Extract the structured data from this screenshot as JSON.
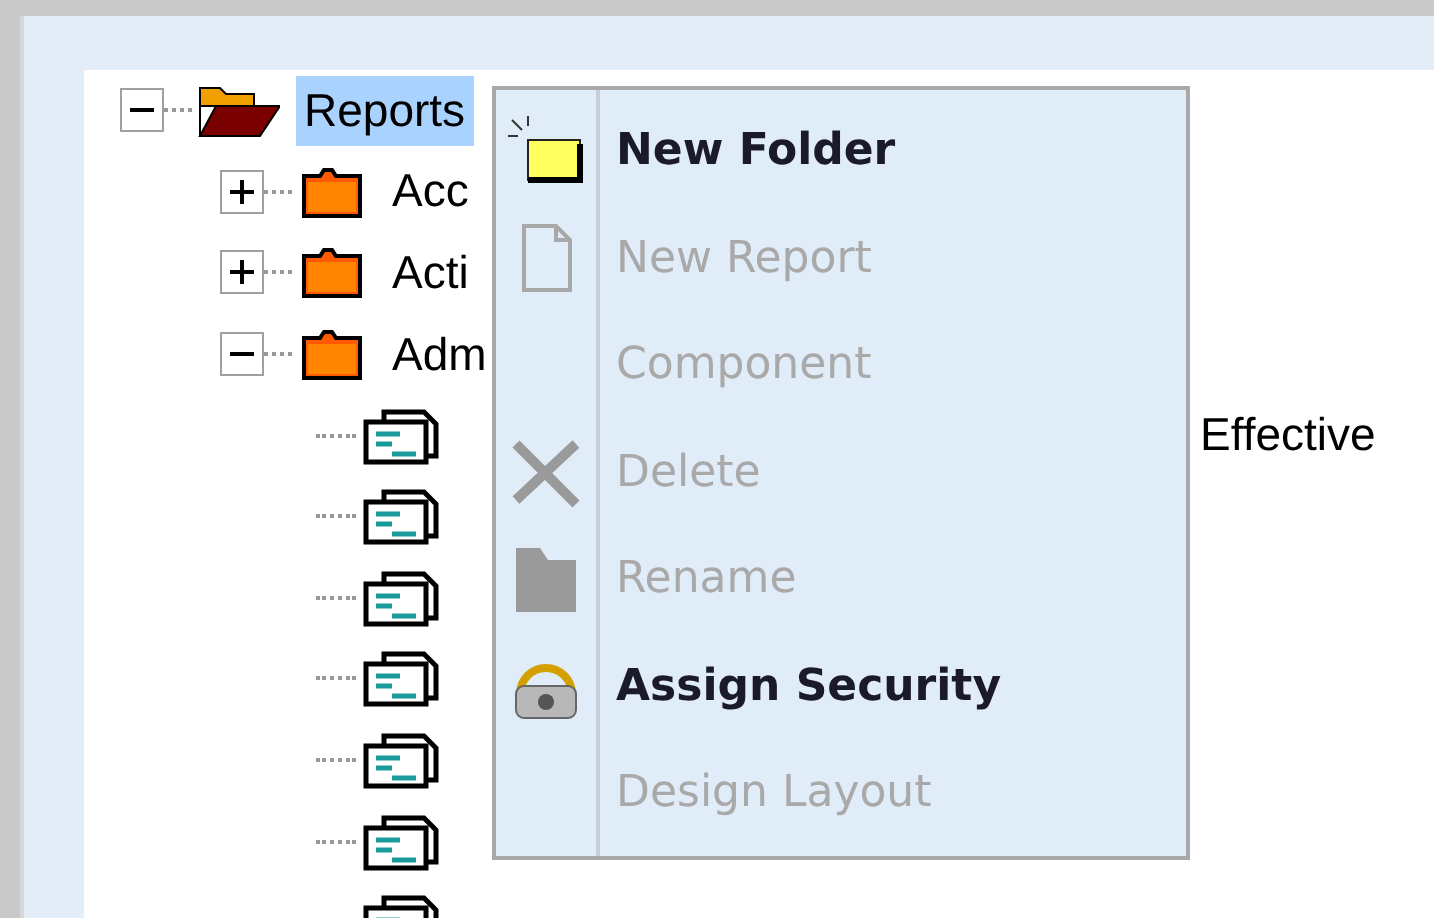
{
  "tree": [
    {
      "label": "Reports",
      "kind": "open-folder",
      "expanded": true,
      "selected": true,
      "children": [
        {
          "label": "Acc",
          "kind": "folder",
          "expanded": false,
          "selected": false
        },
        {
          "label": "Acti",
          "kind": "folder",
          "expanded": false,
          "selected": false
        },
        {
          "label": "Adm",
          "kind": "folder",
          "expanded": true,
          "selected": false,
          "children": [
            {
              "label": "Effective",
              "kind": "report",
              "obscured": true
            },
            {
              "kind": "report"
            },
            {
              "kind": "report"
            },
            {
              "kind": "report"
            },
            {
              "kind": "report"
            },
            {
              "kind": "report"
            },
            {
              "kind": "report"
            }
          ]
        }
      ]
    }
  ],
  "context_menu": [
    {
      "label": "New Folder",
      "kind": "new-folder",
      "disabled": false
    },
    {
      "label": "New Report",
      "kind": "page",
      "disabled": true
    },
    {
      "label": "Component",
      "kind": "plain",
      "disabled": true
    },
    {
      "label": "Delete",
      "kind": "cross",
      "disabled": true
    },
    {
      "label": "Rename",
      "kind": "folder",
      "disabled": true
    },
    {
      "label": "Assign Security",
      "kind": "security",
      "disabled": false
    },
    {
      "label": "Design Layout",
      "kind": "plain",
      "disabled": true
    }
  ]
}
